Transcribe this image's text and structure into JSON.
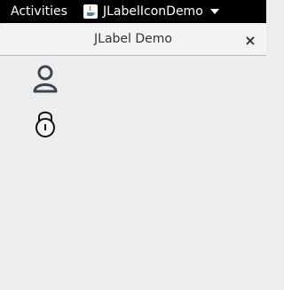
{
  "topbar": {
    "activities_label": "Activities",
    "app_name": "JLabelIconDemo",
    "app_icon": "java-icon"
  },
  "window": {
    "title": "JLabel Demo",
    "close_glyph": "×"
  },
  "content": {
    "labels": [
      {
        "icon": "user-icon"
      },
      {
        "icon": "lock-icon"
      }
    ]
  },
  "colors": {
    "topbar_bg": "#000000",
    "window_bg": "#ededed",
    "titlebar_bg": "#f3f3f3",
    "icon_stroke": "#3d4550"
  }
}
